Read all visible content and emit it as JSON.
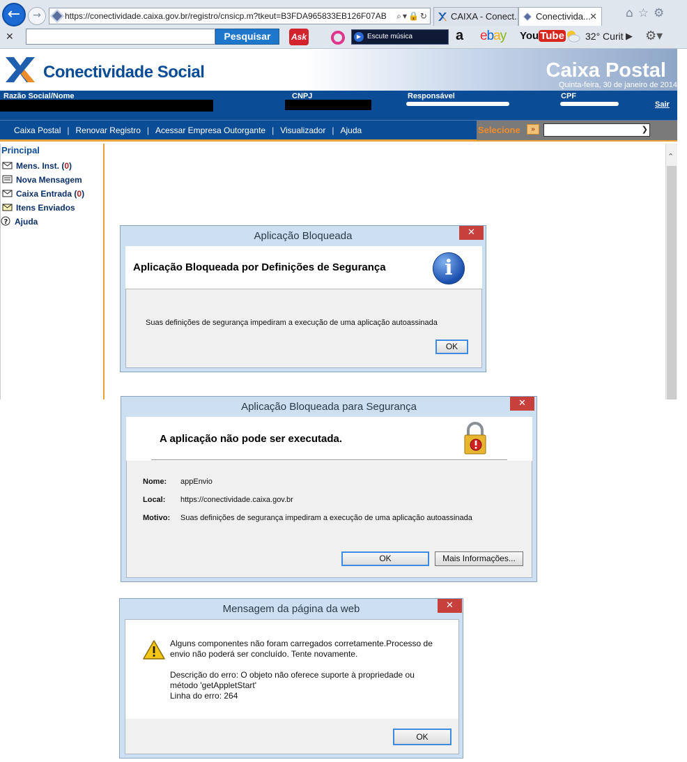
{
  "browser": {
    "url": "https://conectividade.caixa.gov.br/registro/cnsicp.m?tkeut=B3FDA965833EB126F07AB",
    "url_host": "conectividade.caixa.gov.br",
    "tabs": [
      {
        "label": "CAIXA - Conect..."
      },
      {
        "label": "Conectivida..."
      }
    ],
    "toolbar": {
      "search_button": "Pesquisar",
      "ask_label": "Ask",
      "music_label": "Escute música",
      "amazon_label": "a",
      "ebay_label": "ebay",
      "youtube_you": "You",
      "youtube_tube": "Tube",
      "weather": "32° Curit"
    }
  },
  "site": {
    "brand": "Conectividade Social",
    "section": "Caixa Postal",
    "date": "Quinta-feira, 30 de janeiro de 2014",
    "info_labels": {
      "company": "Razão Social/Nome",
      "cnpj": "CNPJ",
      "responsible": "Responsável",
      "cpf": "CPF"
    },
    "logout": "Sair",
    "menu": [
      "Caixa Postal",
      "Renovar Registro",
      "Acessar Empresa Outorgante",
      "Visualizador",
      "Ajuda"
    ],
    "select_label": "Selecione"
  },
  "nav": {
    "title": "Principal",
    "items": [
      {
        "label": "Mens. Inst.",
        "count": "0",
        "icon": "envelope-icon"
      },
      {
        "label": "Nova Mensagem",
        "icon": "new-message-icon"
      },
      {
        "label": "Caixa Entrada",
        "count": "0",
        "icon": "inbox-icon"
      },
      {
        "label": "Itens Enviados",
        "icon": "sent-icon"
      },
      {
        "label": "Ajuda",
        "icon": "help-icon"
      }
    ]
  },
  "dialog_app_blocked": {
    "title": "Aplicação Bloqueada",
    "heading": "Aplicação Bloqueada por Definições de Segurança",
    "message": "Suas definições de segurança impediram a execução de uma aplicação autoassinada",
    "ok": "OK"
  },
  "dialog_security": {
    "title": "Aplicação Bloqueada para Segurança",
    "heading": "A aplicação não pode ser executada.",
    "name_label": "Nome:",
    "name_value": "appEnvio",
    "location_label": "Local:",
    "location_value": "https://conectividade.caixa.gov.br",
    "reason_label": "Motivo:",
    "reason_value": "Suas definições de segurança impediram a execução de uma aplicação autoassinada",
    "ok": "OK",
    "more_info": "Mais Informações..."
  },
  "dialog_web_message": {
    "title": "Mensagem da página da web",
    "line1": "Alguns componentes não foram carregados corretamente.Processo de",
    "line2": "envio não poderá ser concluído. Tente novamente.",
    "line3": "Descrição do erro: O objeto não oferece suporte à propriedade ou",
    "line4": "método 'getAppletStart'",
    "line5": "Linha do erro: 264",
    "ok": "OK"
  },
  "colors": {
    "brand_blue": "#0a4c96",
    "accent_orange": "#e9a23a",
    "close_red": "#c8403b"
  }
}
